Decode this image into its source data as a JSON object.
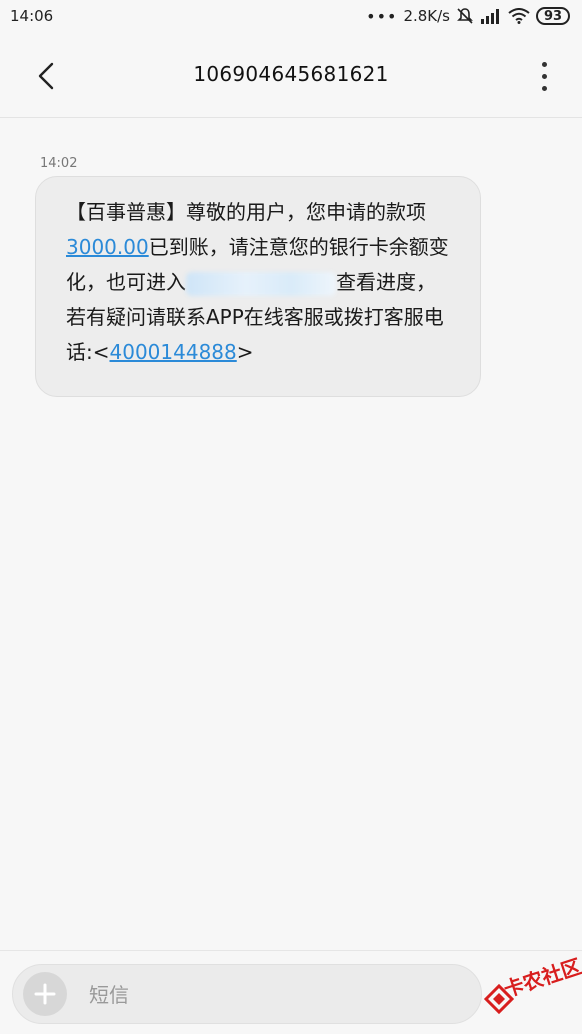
{
  "status_bar": {
    "time": "14:06",
    "speed": "2.8K/s",
    "battery": "93"
  },
  "header": {
    "title": "106904645681621"
  },
  "conversation": {
    "timestamp": "14:02",
    "message": {
      "part1": "【百事普惠】尊敬的用户，您申请的款项",
      "amount": "3000.00",
      "part2": "已到账，请注意您的银行卡余额变化，也可进入",
      "part3": "查看进度，若有疑问请联系APP在线客服或拨打客服电话:<",
      "phone": "4000144888",
      "part4": ">"
    }
  },
  "input_bar": {
    "placeholder": "短信"
  },
  "watermark": {
    "text": "卡农社区"
  },
  "colors": {
    "link": "#2b8ad8",
    "bubble": "#ededed",
    "watermark": "#d81e1e"
  }
}
